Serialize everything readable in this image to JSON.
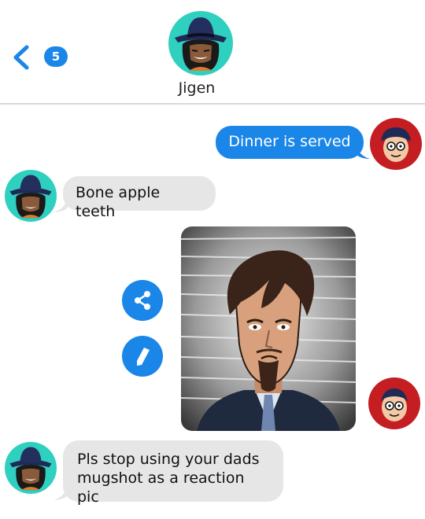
{
  "header": {
    "back_badge": "5",
    "contact_name": "Jigen"
  },
  "messages": {
    "m1": "Dinner is served",
    "m2": "Bone apple teeth",
    "m3_line1": "Pls stop using your dads",
    "m3_line2": "mugshot as a reaction pic"
  },
  "colors": {
    "accent": "#1a86e8",
    "incoming_bubble": "#e6e6e6",
    "user_avatar": "#c41d22",
    "contact_avatar": "#2fd0bf"
  },
  "icons": {
    "back": "chevron-left-icon",
    "share": "share-icon",
    "edit": "pencil-icon"
  }
}
